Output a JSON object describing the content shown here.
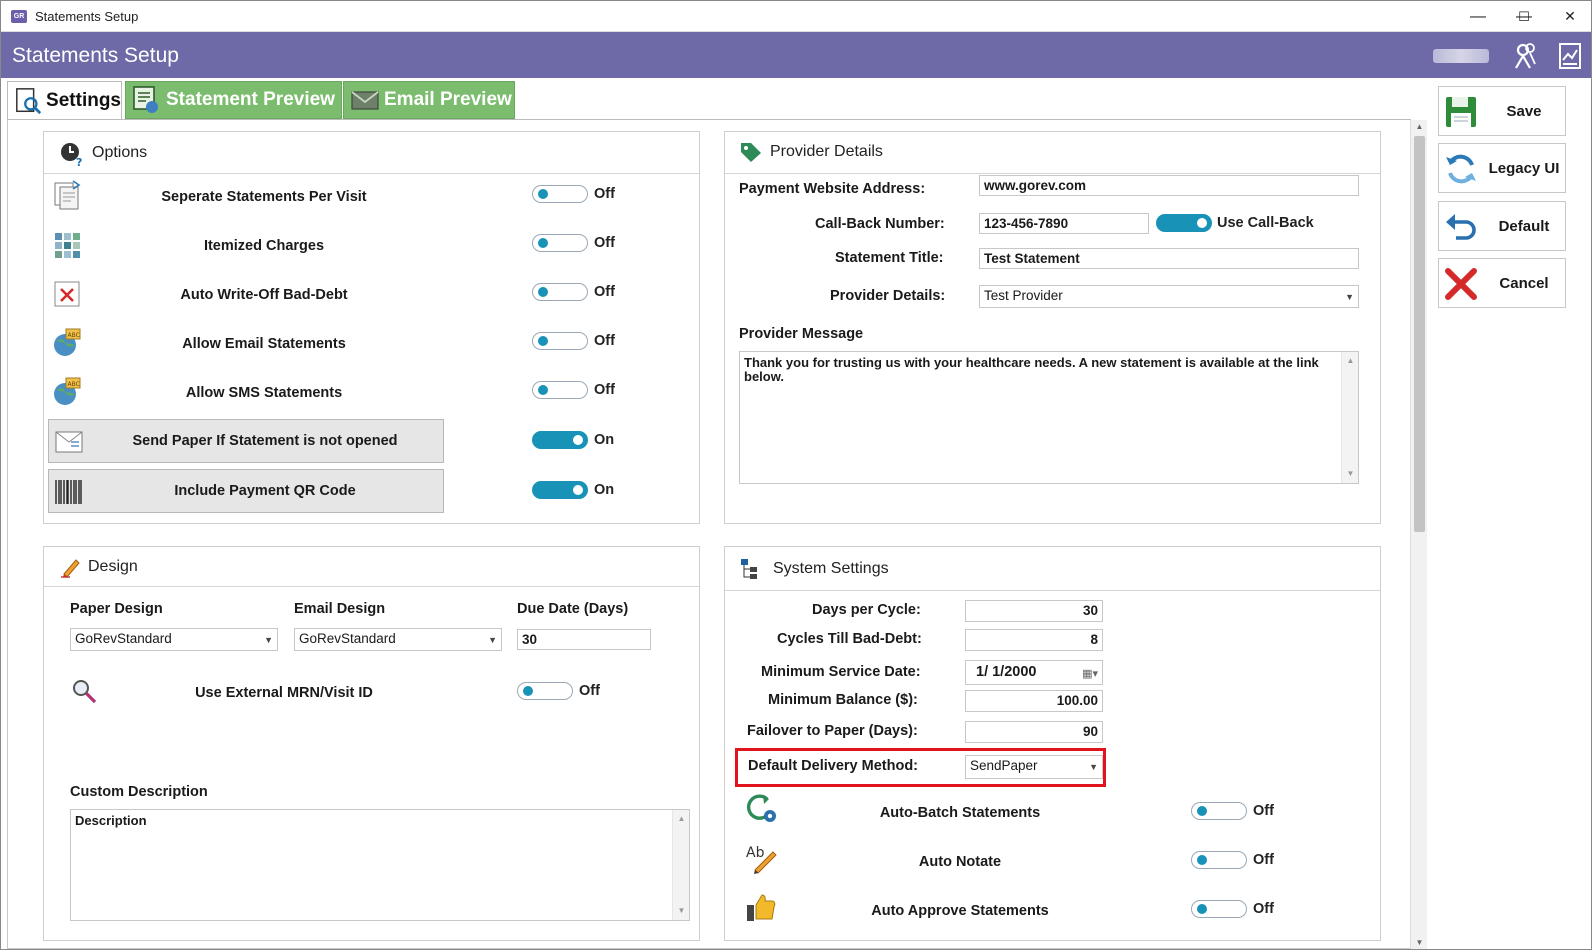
{
  "window": {
    "title": "Statements Setup",
    "minimize": "—",
    "maximize": "☐",
    "close": "✕"
  },
  "header": {
    "title": "Statements Setup"
  },
  "tabs": [
    {
      "label": "Settings"
    },
    {
      "label": "Statement Preview"
    },
    {
      "label": "Email Preview"
    }
  ],
  "options": {
    "title": "Options",
    "items": [
      {
        "label": "Seperate Statements Per Visit",
        "state": "Off"
      },
      {
        "label": "Itemized Charges",
        "state": "Off"
      },
      {
        "label": "Auto Write-Off Bad-Debt",
        "state": "Off"
      },
      {
        "label": "Allow Email Statements",
        "state": "Off"
      },
      {
        "label": "Allow SMS Statements",
        "state": "Off"
      },
      {
        "label": "Send Paper If Statement is not opened",
        "state": "On"
      },
      {
        "label": "Include Payment QR Code",
        "state": "On"
      }
    ]
  },
  "provider": {
    "title": "Provider Details",
    "website_label": "Payment Website Address:",
    "website_value": "www.gorev.com",
    "callback_label": "Call-Back Number:",
    "callback_value": "123-456-7890",
    "use_callback_label": "Use Call-Back",
    "statement_title_label": "Statement Title:",
    "statement_title_value": "Test Statement",
    "provider_details_label": "Provider Details:",
    "provider_details_value": "Test Provider",
    "message_label": "Provider Message",
    "message_value": "Thank you for trusting us with your healthcare needs.  A new statement is available at the link below."
  },
  "design": {
    "title": "Design",
    "paper_label": "Paper Design",
    "paper_value": "GoRevStandard",
    "email_label": "Email Design",
    "email_value": "GoRevStandard",
    "due_label": "Due Date (Days)",
    "due_value": "30",
    "external_label": "Use External MRN/Visit ID",
    "external_state": "Off",
    "custom_label": "Custom Description",
    "custom_value": "Description"
  },
  "system": {
    "title": "System Settings",
    "days_label": "Days per Cycle:",
    "days_value": "30",
    "cycles_label": "Cycles Till Bad-Debt:",
    "cycles_value": "8",
    "min_date_label": "Minimum Service Date:",
    "min_date_value": "1/  1/2000",
    "min_bal_label": "Minimum Balance ($):",
    "min_bal_value": "100.00",
    "failover_label": "Failover to Paper (Days):",
    "failover_value": "90",
    "delivery_label": "Default Delivery Method:",
    "delivery_value": "SendPaper",
    "items": [
      {
        "label": "Auto-Batch Statements",
        "state": "Off"
      },
      {
        "label": "Auto Notate",
        "state": "Off"
      },
      {
        "label": "Auto Approve Statements",
        "state": "Off"
      }
    ]
  },
  "side_buttons": {
    "save": "Save",
    "legacy": "Legacy UI",
    "default": "Default",
    "cancel": "Cancel"
  },
  "colors": {
    "header": "#6d6aa7",
    "tab_inactive": "#7cbc6f",
    "toggle": "#1992b8",
    "highlight": "#e0141e"
  }
}
